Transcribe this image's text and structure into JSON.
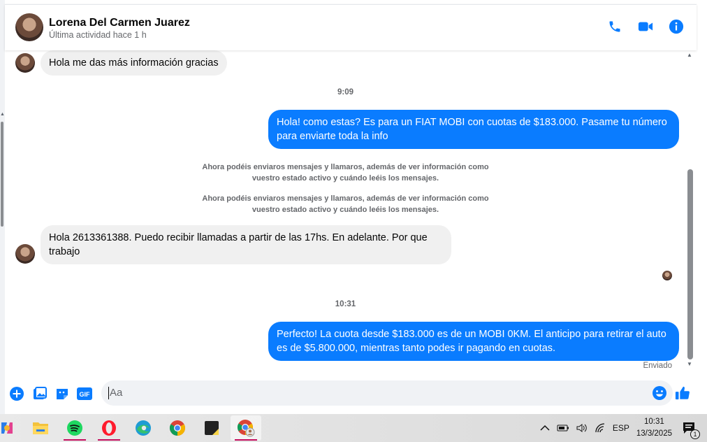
{
  "contact": {
    "name": "Lorena Del Carmen Juarez",
    "status": "Última actividad hace 1 h"
  },
  "header_icons": [
    "phone-icon",
    "video-camera-icon",
    "info-icon"
  ],
  "messages": [
    {
      "from": "them",
      "text": "Hola me das más información gracias"
    },
    {
      "type": "time",
      "text": "9:09"
    },
    {
      "from": "me",
      "text": "Hola! como estas? Es para un FIAT MOBI con cuotas de $183.000. Pasame tu número para enviarte toda la info"
    },
    {
      "type": "system",
      "text": "Ahora podéis enviaros mensajes y llamaros, además de ver información como vuestro estado activo y cuándo leéis los mensajes."
    },
    {
      "type": "system",
      "text": "Ahora podéis enviaros mensajes y llamaros, además de ver información como vuestro estado activo y cuándo leéis los mensajes."
    },
    {
      "from": "them",
      "text": "Hola 2613361388. Puedo recibir llamadas a partir de las 17hs.  En adelante. Por que trabajo"
    },
    {
      "type": "time",
      "text": "10:31"
    },
    {
      "from": "me",
      "text": "Perfecto! La cuota desde $183.000 es de un MOBI 0KM. El anticipo para retirar el auto es de $5.800.000, mientras tanto podes ir pagando en cuotas."
    }
  ],
  "sent_status": "Enviado",
  "composer": {
    "placeholder": "Aa",
    "gif_label": "GIF"
  },
  "taskbar": {
    "apps": [
      "copilot-icon",
      "file-explorer-icon",
      "spotify-icon",
      "opera-icon",
      "edge-icon",
      "chrome-icon",
      "sticky-notes-icon",
      "chrome-profile-icon"
    ],
    "language": "ESP",
    "time": "10:31",
    "date": "13/3/2025",
    "notification_count": "1"
  },
  "colors": {
    "accent": "#0a7cff",
    "incoming_bubble": "#f0f0f0",
    "icon_blue": "#0a7cff"
  }
}
